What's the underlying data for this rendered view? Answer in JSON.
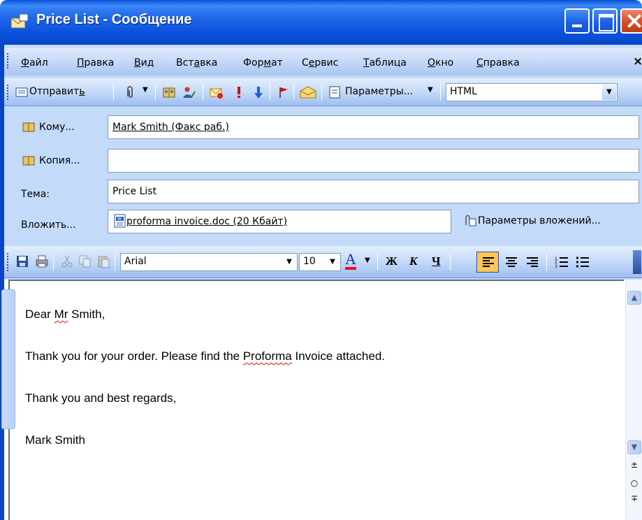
{
  "window": {
    "title": "Price List - Сообщение"
  },
  "menubar": {
    "items": [
      "Файл",
      "Правка",
      "Вид",
      "Вставка",
      "Формат",
      "Сервис",
      "Таблица",
      "Окно",
      "Справка"
    ],
    "close_glyph": "×"
  },
  "toolbar_standard": {
    "send_label": "Отправить",
    "options_label": "Параметры...",
    "format_value": "HTML",
    "icons": [
      "attach-icon",
      "address-book-icon",
      "check-names-icon",
      "flag-envelope-icon",
      "importance-high-icon",
      "importance-low-icon",
      "follow-up-flag-icon",
      "envelope-icon",
      "options-icon"
    ]
  },
  "header": {
    "to_label": "Кому...",
    "to_value": "Mark Smith (Факс раб.)",
    "cc_label": "Копия...",
    "cc_value": "",
    "subject_label": "Тема:",
    "subject_value": "Price List",
    "attach_label": "Вложить...",
    "attach_value": "proforma invoice.doc (20 Кбайт)",
    "attach_options_label": "Параметры вложений..."
  },
  "toolbar_format": {
    "font_name": "Arial",
    "font_size": "10",
    "bold_label": "Ж",
    "italic_label": "К",
    "underline_label": "Ч",
    "font_color_label": "A",
    "font_color": "#E0151B",
    "active_align": "left"
  },
  "message": {
    "greeting_pre": "Dear ",
    "greeting_word": "Mr",
    "greeting_post": " Smith,",
    "line2_pre": "Thank you for your order. Please find the ",
    "line2_word": "Proforma",
    "line2_post": " Invoice attached.",
    "line3": "Thank you and best regards,",
    "line4": "Mark Smith"
  },
  "colors": {
    "titlebar": "#0A52DE",
    "command_bg": "#C3DAF9",
    "highlight": "#FFC55A"
  }
}
